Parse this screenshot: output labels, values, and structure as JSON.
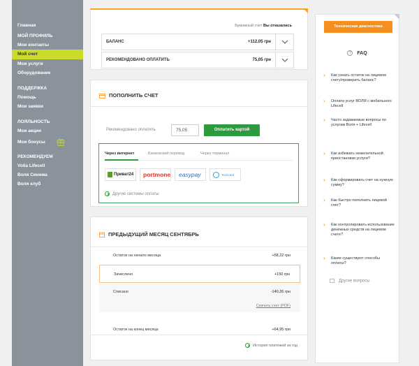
{
  "sidebar": {
    "items": [
      {
        "label": "Главная"
      },
      {
        "label": "МОЙ ПРОФИЛЬ"
      },
      {
        "label": "Мои контакты"
      },
      {
        "label": "Мой счет"
      },
      {
        "label": "Мои услуги"
      },
      {
        "label": "Оборудование"
      },
      {
        "label": "ПОДДЕРЖКА"
      },
      {
        "label": "Помощь"
      },
      {
        "label": "Мои заявки"
      },
      {
        "label": "ЛОЯЛЬНОСТЬ"
      },
      {
        "label": "Мои акции"
      },
      {
        "label": "Мои бонусы"
      },
      {
        "label": "РЕКОМЕНДУЕМ"
      },
      {
        "label": "Volia Lifecell"
      },
      {
        "label": "Воля Синема"
      },
      {
        "label": "Воля клуб"
      }
    ]
  },
  "balance": {
    "paper_label": "Бумажный счет",
    "paper_value": "Вы отказались",
    "rows": [
      {
        "label": "БАЛАНС",
        "value": "+112,05 грн"
      },
      {
        "label": "РЕКОМЕНДОВАНО ОПЛАТИТЬ",
        "value": "75,05 грн"
      }
    ]
  },
  "topup": {
    "title": "ПОПОЛНИТЬ СЧЕТ",
    "recommended_label": "Рекомендовано оплатить",
    "amount": "75,05",
    "pay_button": "Оплатить картой",
    "tabs": [
      "Через интернет",
      "Банковский перевод",
      "Через терминал"
    ],
    "logos": [
      "Приват24",
      "portmone",
      "easypay",
      "Techcard"
    ],
    "other_systems": "Другие системы оплаты"
  },
  "prev_month": {
    "title": "ПРЕДЫДУЩИЙ МЕСЯЦ СЕНТЯБРЬ",
    "rows": [
      {
        "label": "Остаток на начало месяца",
        "value": "+58,22 грн"
      },
      {
        "label": "Зачислено",
        "value": "+150 грн"
      },
      {
        "label": "Списано",
        "value": "-140,26 грн"
      },
      {
        "label": "Остаток на конец месяца",
        "value": "+64,95 грн"
      }
    ],
    "pdf_link": "Скачать счет (PDF)",
    "history_link": "История платежей за год"
  },
  "right_panel": {
    "diag_button": "Техническая диагностика",
    "faq_title": "FAQ",
    "questions": [
      "Как узнать остаток на лицевом счету/проверить баланс?",
      "Оплата услуг ВОЛЯ с мобильного Lifecell",
      "Часто задаваемые вопросы по услугам Воля + Lifecell",
      "Как избежать нежелательной приостановки услуги?",
      "Как сформировать счет на нужную сумму?",
      "Как быстро пополнить лицевой счет?",
      "Как контролировать использование денежных средств на лицевом счете?",
      "Какие существуют способы оплаты?"
    ],
    "other_questions": "Другие вопросы"
  },
  "colors": {
    "accent": "#f58f1f",
    "sidebar": "#8a929b",
    "active": "#cbdb2a",
    "green": "#2e9a3e"
  }
}
